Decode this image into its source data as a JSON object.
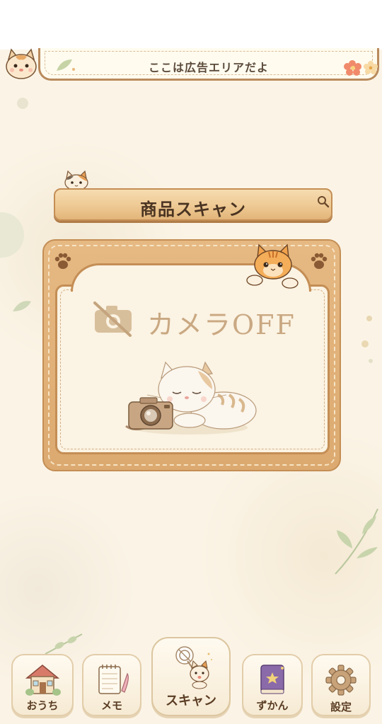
{
  "ad": {
    "text": "ここは広告エリアだよ"
  },
  "scan": {
    "title": "商品スキャン",
    "camera_status": "カメラOFF"
  },
  "nav": {
    "items": [
      {
        "label": "おうち",
        "icon": "house-icon"
      },
      {
        "label": "メモ",
        "icon": "memo-icon"
      },
      {
        "label": "スキャン",
        "icon": "scan-cat-icon"
      },
      {
        "label": "ずかん",
        "icon": "book-icon"
      },
      {
        "label": "設定",
        "icon": "gear-icon"
      }
    ]
  },
  "colors": {
    "background": "#fbf4e6",
    "wood": "#e6b983",
    "accent_text": "#5b3d24"
  }
}
